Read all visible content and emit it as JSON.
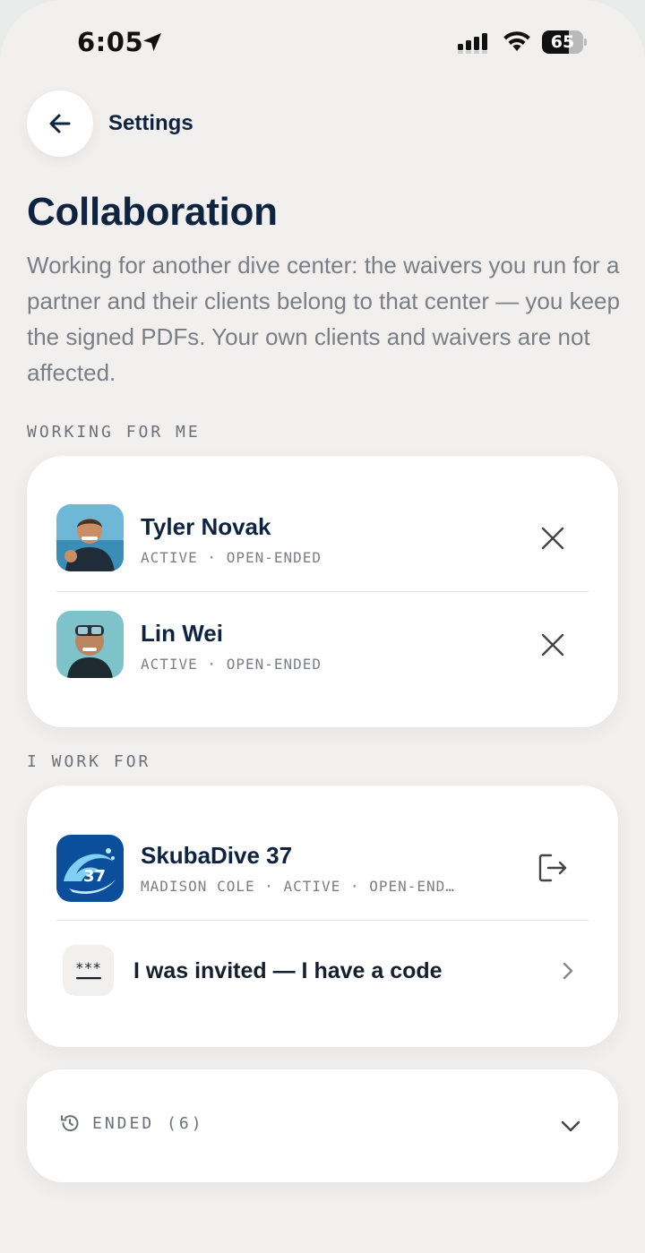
{
  "status_bar": {
    "time": "6:05",
    "battery_percent": "65",
    "battery_level": 0.65
  },
  "header": {
    "back_label": "Settings"
  },
  "page": {
    "title": "Collaboration",
    "description": "Working for another dive center: the waivers you run for a partner and their clients belong to that center — you keep the signed PDFs. Your own clients and waivers are not affected."
  },
  "working_for_me": {
    "section_label": "WORKING FOR ME",
    "items": [
      {
        "name": "Tyler Novak",
        "meta": "ACTIVE · OPEN-ENDED",
        "action_icon": "close-icon"
      },
      {
        "name": "Lin Wei",
        "meta": "ACTIVE · OPEN-ENDED",
        "action_icon": "close-icon"
      }
    ]
  },
  "i_work_for": {
    "section_label": "I WORK FOR",
    "items": [
      {
        "name": "SkubaDive 37",
        "meta": "MADISON COLE · ACTIVE · OPEN-END…",
        "action_icon": "leave-icon"
      }
    ],
    "invite": {
      "label": "I was invited — I have a code",
      "tile_text": "***"
    }
  },
  "ended": {
    "label": "ENDED (6)"
  },
  "colors": {
    "background": "#f1f0ee",
    "card": "#ffffff",
    "title": "#0d2340",
    "muted": "#7b7f85",
    "logo_blue": "#0b4f9c"
  }
}
